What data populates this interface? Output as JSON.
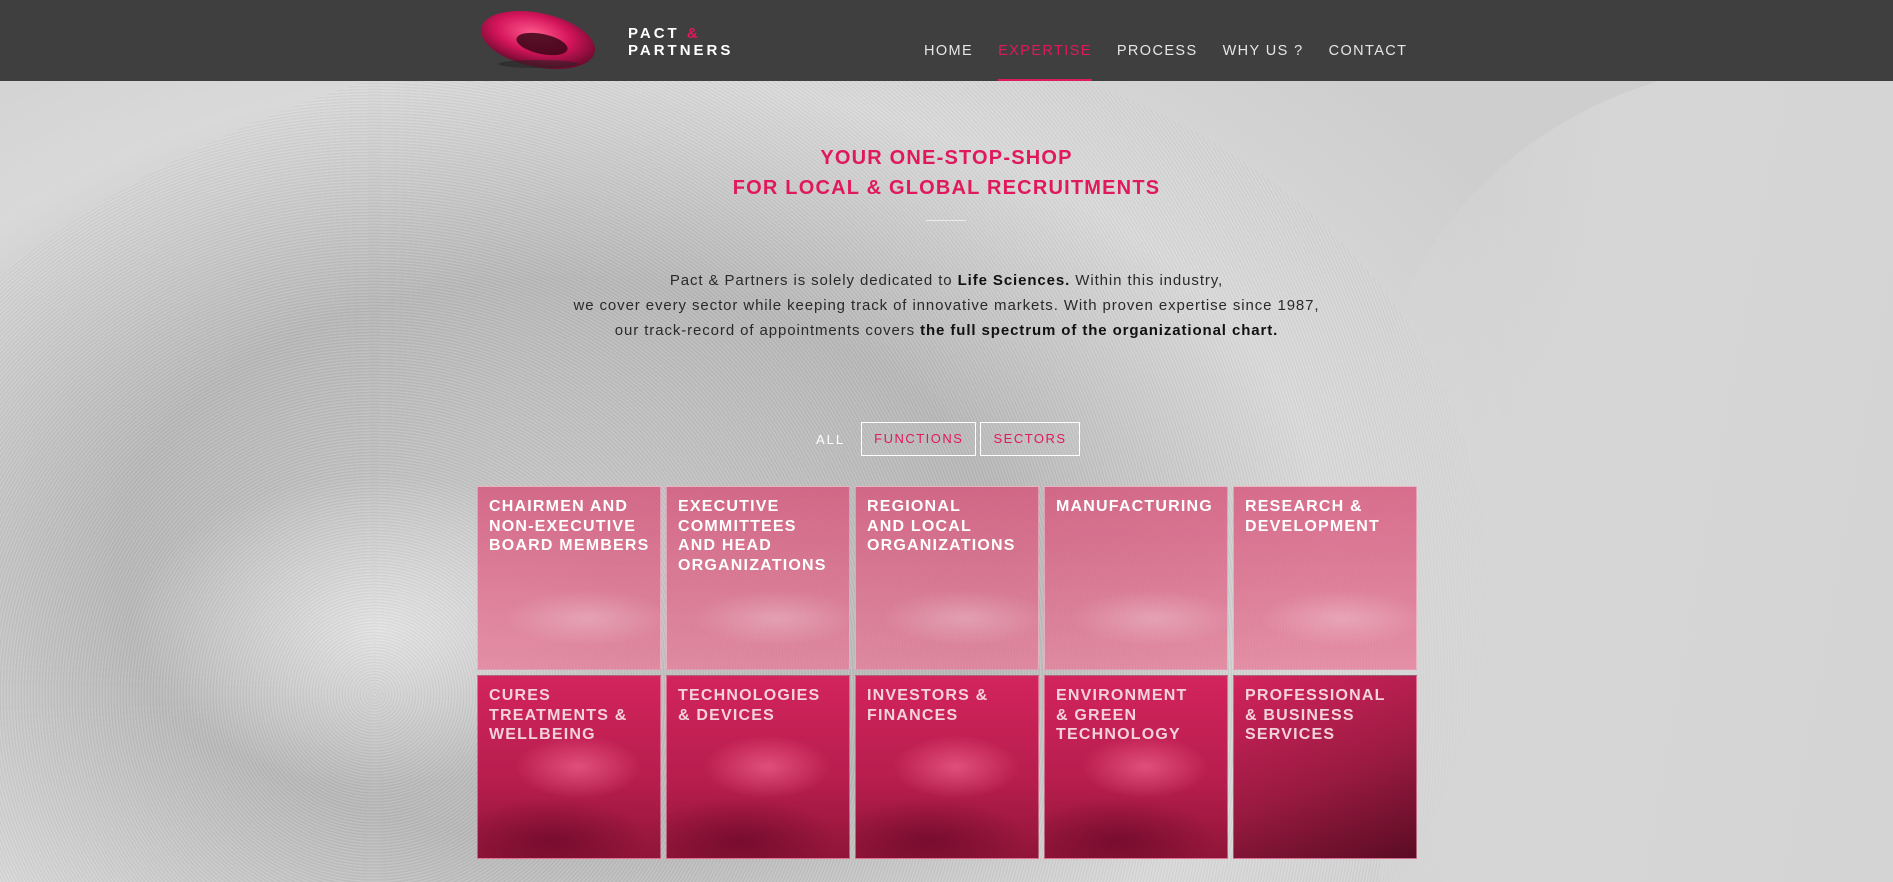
{
  "header": {
    "logo_line1": "PACT",
    "logo_amp": "&",
    "logo_line2": "PARTNERS",
    "nav": [
      "HOME",
      "EXPERTISE",
      "PROCESS",
      "WHY US ?",
      "CONTACT"
    ],
    "active_nav": "EXPERTISE"
  },
  "hero": {
    "headline_1": "YOUR ONE-STOP-SHOP",
    "headline_2": "FOR LOCAL & GLOBAL RECRUITMENTS",
    "intro": {
      "l1_a": "Pact & Partners is solely dedicated to ",
      "l1_b": "Life Sciences.",
      "l1_c": " Within this industry,",
      "l2": "we cover every sector while keeping track of innovative markets. With proven expertise since 1987,",
      "l3_a": "our track-record of appointments covers ",
      "l3_b": "the full spectrum of the organizational chart."
    }
  },
  "filters": {
    "all": "ALL",
    "functions": "FUNCTIONS",
    "sectors": "SECTORS"
  },
  "tiles": [
    {
      "lines": [
        "CHAIRMEN AND",
        "NON-EXECUTIVE",
        "BOARD MEMBERS"
      ]
    },
    {
      "lines": [
        "EXECUTIVE",
        "COMMITTEES",
        "AND HEAD",
        "ORGANIZATIONS"
      ]
    },
    {
      "lines": [
        "REGIONAL",
        "AND LOCAL",
        "ORGANIZATIONS"
      ]
    },
    {
      "lines": [
        "MANUFACTURING"
      ]
    },
    {
      "lines": [
        "RESEARCH &",
        "DEVELOPMENT"
      ]
    },
    {
      "lines": [
        "CURES",
        "TREATMENTS &",
        "WELLBEING"
      ]
    },
    {
      "lines": [
        "TECHNOLOGIES",
        "& DEVICES"
      ]
    },
    {
      "lines": [
        "INVESTORS &",
        "FINANCES"
      ]
    },
    {
      "lines": [
        "ENVIRONMENT",
        "& GREEN",
        "TECHNOLOGY"
      ]
    },
    {
      "lines": [
        "PROFESSIONAL",
        "& BUSINESS",
        "SERVICES"
      ]
    }
  ],
  "colors": {
    "accent": "#e0195a",
    "header_bg": "#3f3f3f"
  }
}
